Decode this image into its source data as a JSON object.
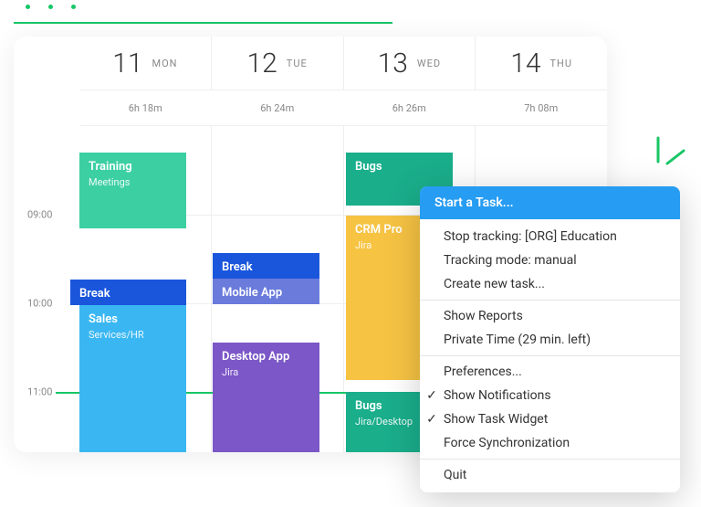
{
  "days": [
    {
      "num": "11",
      "name": "MON",
      "dur": "6h 18m"
    },
    {
      "num": "12",
      "name": "TUE",
      "dur": "6h 24m"
    },
    {
      "num": "13",
      "name": "WED",
      "dur": "6h 26m"
    },
    {
      "num": "14",
      "name": "THU",
      "dur": "7h 08m"
    }
  ],
  "times": {
    "t9": "09:00",
    "t10": "10:00",
    "t11": "11:00"
  },
  "events": {
    "training": {
      "title": "Training",
      "sub": "Meetings"
    },
    "break1": {
      "title": "Break"
    },
    "sales": {
      "title": "Sales",
      "sub": "Services/HR"
    },
    "break2": {
      "title": "Break"
    },
    "mobileapp": {
      "title": "Mobile App"
    },
    "desktopapp": {
      "title": "Desktop App",
      "sub": "Jira"
    },
    "bugs1": {
      "title": "Bugs"
    },
    "crm": {
      "title": "CRM Pro",
      "sub": "Jira"
    },
    "bugs2": {
      "title": "Bugs",
      "sub": "Jira/Desktop"
    }
  },
  "menu": {
    "header": "Start a Task...",
    "stop": "Stop tracking: [ORG] Education",
    "mode": "Tracking mode: manual",
    "create": "Create new task...",
    "reports": "Show Reports",
    "private": "Private Time (29 min. left)",
    "prefs": "Preferences...",
    "notif": "Show Notifications",
    "widget": "Show Task Widget",
    "sync": "Force Synchronization",
    "quit": "Quit"
  },
  "check": "✓"
}
